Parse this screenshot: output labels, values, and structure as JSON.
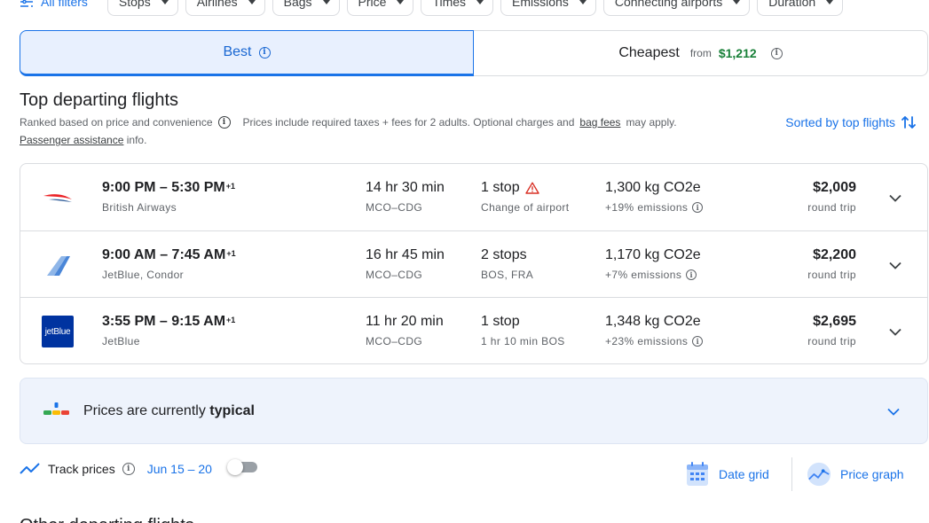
{
  "filters": {
    "all_filters_label": "All filters",
    "chips": [
      "Stops",
      "Airlines",
      "Bags",
      "Price",
      "Times",
      "Emissions",
      "Connecting airports",
      "Duration"
    ]
  },
  "tabs": {
    "best_label": "Best",
    "cheapest_label": "Cheapest",
    "cheapest_from": "from",
    "cheapest_price": "$1,212"
  },
  "section": {
    "title": "Top departing flights",
    "ranked_text": "Ranked based on price and convenience",
    "prices_text": "Prices include required taxes + fees for 2 adults. Optional charges and",
    "bag_fees": "bag fees",
    "may_apply": "may apply.",
    "passenger_assistance": "Passenger assistance",
    "info_text": "info.",
    "sorted_label": "Sorted by top flights"
  },
  "flights": [
    {
      "times": "9:00 PM – 5:30 PM",
      "day_offset": "+1",
      "airline": "British Airways",
      "duration": "14 hr 30 min",
      "route": "MCO–CDG",
      "stops": "1 stop",
      "stop_detail": "Change of airport",
      "emissions": "1,300 kg CO2e",
      "emissions_delta": "+19% emissions",
      "price": "$2,009",
      "price_type": "round trip"
    },
    {
      "times": "9:00 AM – 7:45 AM",
      "day_offset": "+1",
      "airline": "JetBlue, Condor",
      "duration": "16 hr 45 min",
      "route": "MCO–CDG",
      "stops": "2 stops",
      "stop_detail": "BOS, FRA",
      "emissions": "1,170 kg CO2e",
      "emissions_delta": "+7% emissions",
      "price": "$2,200",
      "price_type": "round trip"
    },
    {
      "times": "3:55 PM – 9:15 AM",
      "day_offset": "+1",
      "airline": "JetBlue",
      "duration": "11 hr 20 min",
      "route": "MCO–CDG",
      "stops": "1 stop",
      "stop_detail": "1 hr 10 min BOS",
      "emissions": "1,348 kg CO2e",
      "emissions_delta": "+23% emissions",
      "price": "$2,695",
      "price_type": "round trip",
      "logo_text": "jetBlue"
    }
  ],
  "insights": {
    "text_prefix": "Prices are currently",
    "text_bold": "typical"
  },
  "tools": {
    "track_label": "Track prices",
    "track_dates": "Jun 15 – 20",
    "date_grid": "Date grid",
    "price_graph": "Price graph"
  },
  "other_section_title": "Other departing flights",
  "colors": {
    "accent": "#1a73e8",
    "green_price": "#188038",
    "warning": "#d93025",
    "jetblue": "#0033a0"
  }
}
